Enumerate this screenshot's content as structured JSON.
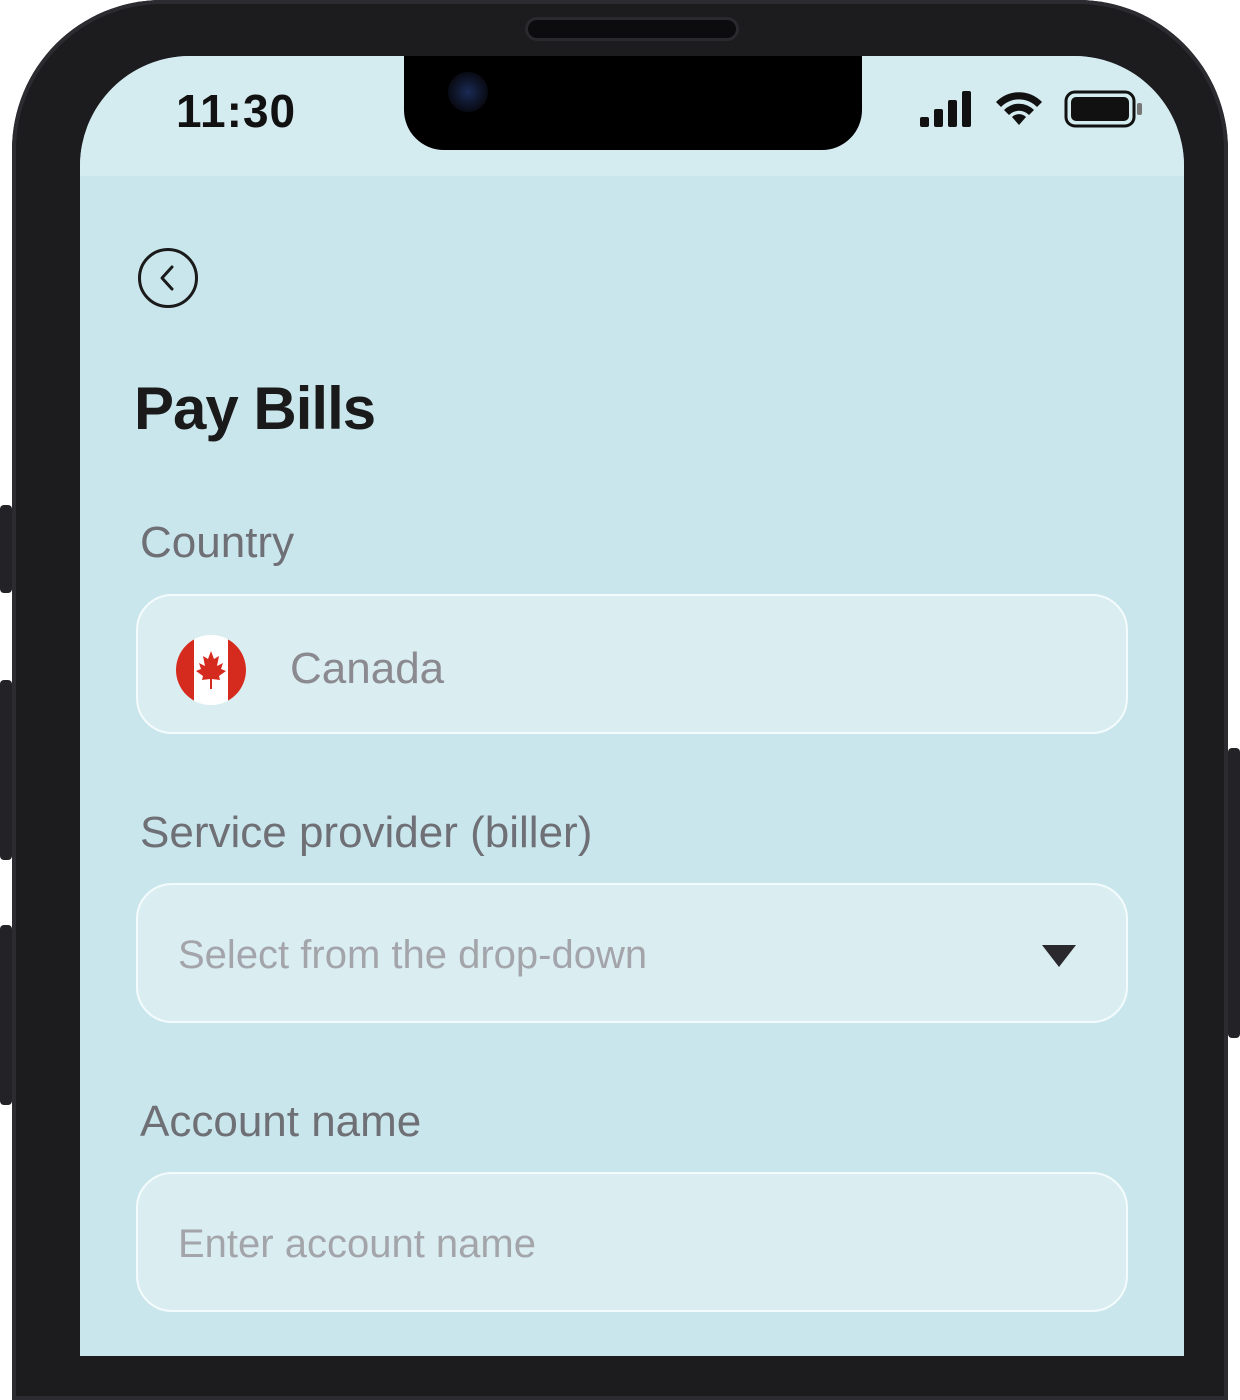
{
  "status_bar": {
    "time": "11:30",
    "icons": [
      "cellular-signal-icon",
      "wifi-icon",
      "battery-icon"
    ]
  },
  "header": {
    "back_icon": "chevron-left-icon",
    "title": "Pay Bills"
  },
  "form": {
    "country": {
      "label": "Country",
      "value": "Canada",
      "flag_icon": "canada-flag-icon"
    },
    "biller": {
      "label": "Service provider (biller)",
      "placeholder": "Select from the drop-down",
      "caret_icon": "caret-down-icon"
    },
    "account_name": {
      "label": "Account name",
      "placeholder": "Enter account name"
    }
  },
  "colors": {
    "screen_background": "#c9e6ec",
    "field_background": "#daeef2",
    "flag_red": "#d52b1e"
  }
}
